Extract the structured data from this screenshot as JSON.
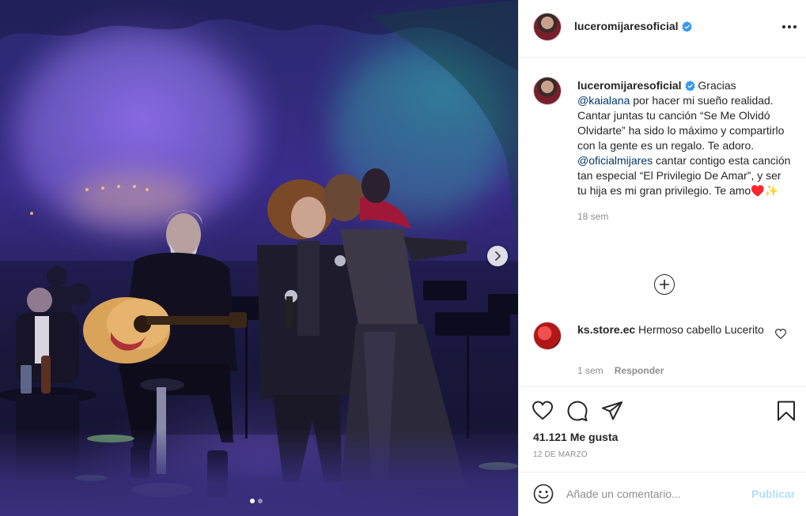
{
  "post": {
    "username": "luceromijaresoficial",
    "more_options_icon": "more-horizontal-icon",
    "verified_icon": "verified-badge-icon"
  },
  "caption": {
    "username": "luceromijaresoficial",
    "text_1": " Gracias ",
    "mention_1": "@kaialana",
    "text_2": " por hacer mi sueño realidad. Cantar juntas tu canción “Se Me Olvidó Olvidarte” ha sido lo máximo y compartirlo con la gente es un regalo. Te adoro. ",
    "mention_2": "@oficialmijares",
    "text_3": " cantar contigo esta canción tan especial “El Privilegio De Amar”, y ser tu hija es mi gran privilegio. Te amo♥️",
    "emoji": "✨",
    "time": "18 sem"
  },
  "load_more_icon": "plus-circle-icon",
  "comment": {
    "username": "ks.store.ec",
    "text": " Hermoso cabello Lucerito",
    "time": "1 sem",
    "reply_label": "Responder",
    "like_icon": "heart-icon"
  },
  "actions": {
    "like_icon": "heart-icon",
    "comment_icon": "comment-icon",
    "share_icon": "paper-plane-icon",
    "save_icon": "bookmark-icon",
    "likes": "41.121 Me gusta",
    "date": "12 de marzo"
  },
  "comment_box": {
    "emoji_icon": "smiley-icon",
    "placeholder": "Añade un comentario...",
    "post_label": "Publicar"
  },
  "carousel": {
    "next_icon": "chevron-right-icon",
    "slide_count": 2,
    "current_slide": 1
  },
  "colors": {
    "mention": "#00376b",
    "muted": "#8e8e8e",
    "publish_disabled": "#b2dffc",
    "verified": "#3897f0"
  }
}
